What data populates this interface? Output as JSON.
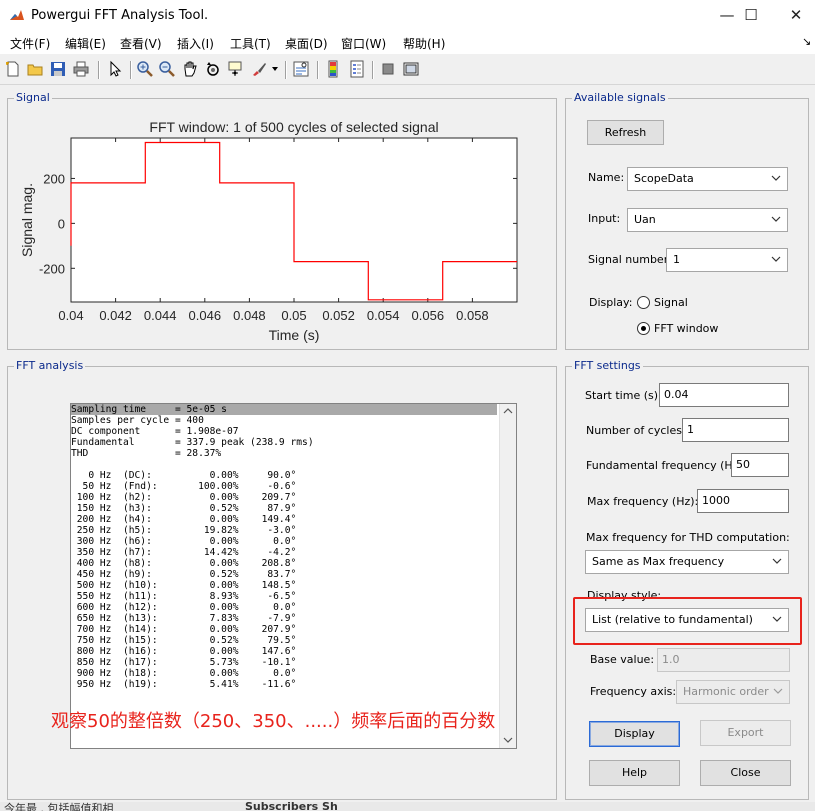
{
  "window": {
    "title": "Powergui FFT Analysis Tool.",
    "minimize": "—",
    "maximize": "☐",
    "close": "✕"
  },
  "menu": [
    "文件(F)",
    "编辑(E)",
    "查看(V)",
    "插入(I)",
    "工具(T)",
    "桌面(D)",
    "窗口(W)",
    "帮助(H)"
  ],
  "menu_overflow": "↘",
  "toolbar": {
    "icons": [
      "new-file-icon",
      "open-folder-icon",
      "save-icon",
      "print-icon",
      "pointer-icon",
      "zoom-in-icon",
      "zoom-out-icon",
      "pan-icon",
      "rotate-icon",
      "data-cursor-icon",
      "brush-icon",
      "link-plot-icon",
      "colorbar-icon",
      "legend-icon",
      "hide-plot-tools-icon",
      "show-plot-tools-icon"
    ]
  },
  "signal_panel": {
    "title": "Signal"
  },
  "chart_data": {
    "type": "line",
    "title": "FFT window: 1 of 500 cycles of selected signal",
    "xlabel": "Time (s)",
    "ylabel": "Signal mag.",
    "xlim": [
      0.04,
      0.06
    ],
    "ylim": [
      -350,
      380
    ],
    "xticks": [
      0.04,
      0.042,
      0.044,
      0.046,
      0.048,
      0.05,
      0.052,
      0.054,
      0.056,
      0.058
    ],
    "xtick_labels": [
      "0.04",
      "0.042",
      "0.044",
      "0.046",
      "0.048",
      "0.05",
      "0.052",
      "0.054",
      "0.056",
      "0.058"
    ],
    "yticks": [
      200,
      0,
      -200
    ],
    "ytick_labels": [
      "200",
      "0",
      "-200"
    ],
    "series": [
      {
        "color": "#ff0000",
        "x": [
          0.04,
          0.04,
          0.04333,
          0.04333,
          0.04667,
          0.04667,
          0.05,
          0.05,
          0.05333,
          0.05333,
          0.05667,
          0.05667,
          0.06
        ],
        "y": [
          -100,
          180,
          180,
          360,
          360,
          180,
          180,
          -170,
          -170,
          -340,
          -340,
          -170,
          -170
        ]
      }
    ]
  },
  "available_signals": {
    "title": "Available signals",
    "refresh": "Refresh",
    "name_label": "Name:",
    "name_value": "ScopeData",
    "input_label": "Input:",
    "input_value": "Uan",
    "signal_number_label": "Signal number:",
    "signal_number_value": "1",
    "display_label": "Display:",
    "display_options": [
      "Signal",
      "FFT window"
    ],
    "display_selected": "FFT window"
  },
  "fft_analysis": {
    "title": "FFT analysis",
    "header_line": "Sampling time     = 5e-05 s",
    "lines": [
      "Samples per cycle = 400",
      "DC component      = 1.908e-07",
      "Fundamental       = 337.9 peak (238.9 rms)",
      "THD               = 28.37%",
      "",
      "   0 Hz  (DC):          0.00%     90.0°",
      "  50 Hz  (Fnd):       100.00%     -0.6°",
      " 100 Hz  (h2):          0.00%    209.7°",
      " 150 Hz  (h3):          0.52%     87.9°",
      " 200 Hz  (h4):          0.00%    149.4°",
      " 250 Hz  (h5):         19.82%     -3.0°",
      " 300 Hz  (h6):          0.00%      0.0°",
      " 350 Hz  (h7):         14.42%     -4.2°",
      " 400 Hz  (h8):          0.00%    208.8°",
      " 450 Hz  (h9):          0.52%     83.7°",
      " 500 Hz  (h10):         0.00%    148.5°",
      " 550 Hz  (h11):         8.93%     -6.5°",
      " 600 Hz  (h12):         0.00%      0.0°",
      " 650 Hz  (h13):         7.83%     -7.9°",
      " 700 Hz  (h14):         0.00%    207.9°",
      " 750 Hz  (h15):         0.52%     79.5°",
      " 800 Hz  (h16):         0.00%    147.6°",
      " 850 Hz  (h17):         5.73%    -10.1°",
      " 900 Hz  (h18):         0.00%      0.0°",
      " 950 Hz  (h19):         5.41%    -11.6°"
    ]
  },
  "fft_settings": {
    "title": "FFT settings",
    "start_time_label": "Start time (s):",
    "start_time_value": "0.04",
    "cycles_label": "Number of cycles:",
    "cycles_value": "1",
    "fund_freq_label": "Fundamental frequency (Hz):",
    "fund_freq_value": "50",
    "max_freq_label": "Max frequency (Hz):",
    "max_freq_value": "1000",
    "thd_label": "Max frequency for THD computation:",
    "thd_value": "Same as Max frequency",
    "display_style_label": "Display style:",
    "display_style_value": "List (relative to fundamental)",
    "base_value_label": "Base value:",
    "base_value_value": "1.0",
    "freq_axis_label": "Frequency axis:",
    "freq_axis_value": "Harmonic order",
    "display_btn": "Display",
    "export_btn": "Export",
    "help_btn": "Help",
    "close_btn": "Close"
  },
  "annotation": {
    "text": "观察50的整倍数（250、350、.....）频率后面的百分数",
    "color": "#e8231c"
  },
  "taskbar": {
    "left_text": "今年最 . 包括幅值和相",
    "mid_text": "Subscribers Sh"
  }
}
